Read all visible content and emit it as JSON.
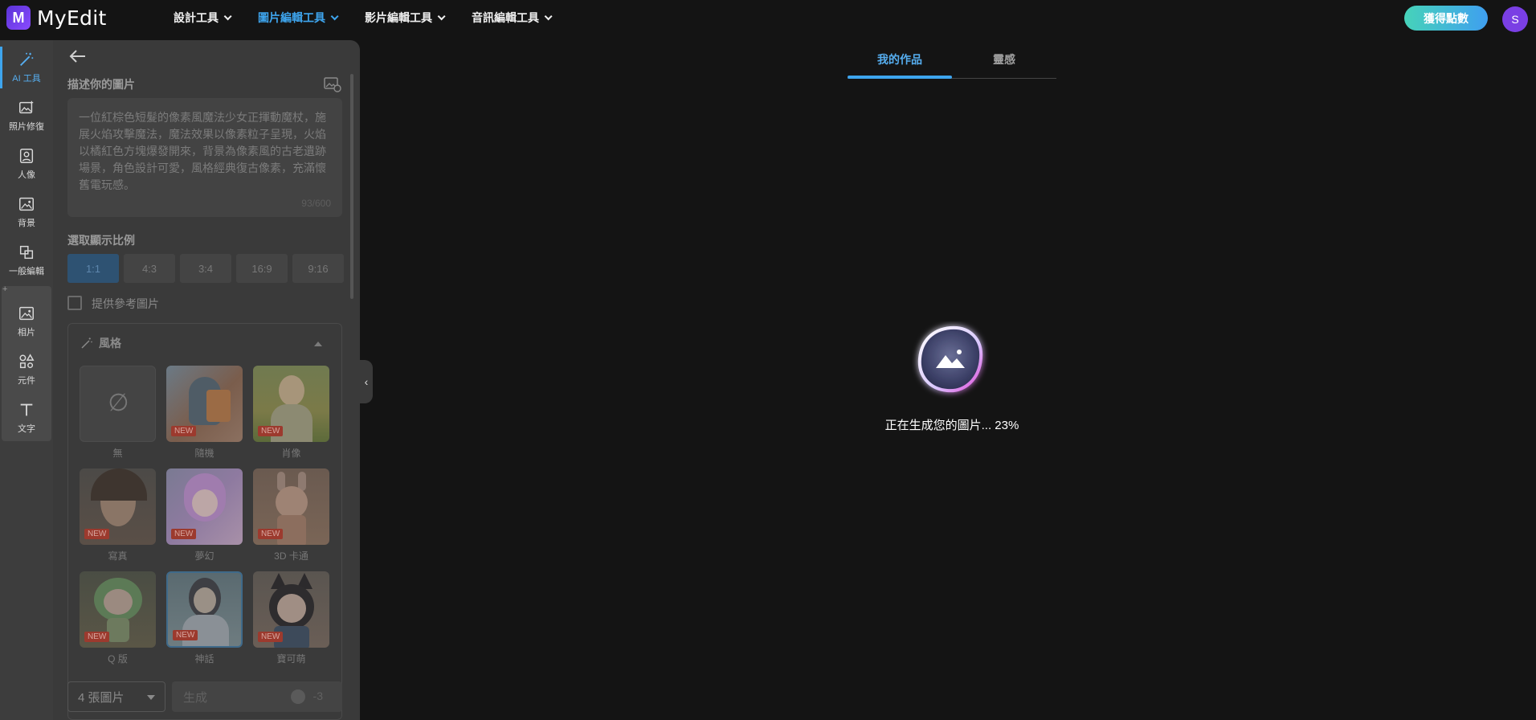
{
  "app": {
    "name": "MyEdit",
    "logo_letter": "M"
  },
  "nav": {
    "items": [
      {
        "label": "設計工具",
        "active": false
      },
      {
        "label": "圖片編輯工具",
        "active": true
      },
      {
        "label": "影片編輯工具",
        "active": false
      },
      {
        "label": "音訊編輯工具",
        "active": false
      }
    ]
  },
  "header": {
    "points_button": "獲得點數",
    "avatar_initial": "S"
  },
  "rail": {
    "items": [
      {
        "label": "AI 工具",
        "icon": "magic-wand-icon",
        "active": true
      },
      {
        "label": "照片修復",
        "icon": "photo-restore-icon",
        "active": false
      },
      {
        "label": "人像",
        "icon": "portrait-icon",
        "active": false
      },
      {
        "label": "背景",
        "icon": "background-icon",
        "active": false
      },
      {
        "label": "一般編輯",
        "icon": "crop-icon",
        "active": false
      },
      {
        "label": "相片",
        "icon": "image-icon",
        "active": false
      },
      {
        "label": "元件",
        "icon": "shapes-icon",
        "active": false
      },
      {
        "label": "文字",
        "icon": "text-icon",
        "active": false
      }
    ]
  },
  "panel": {
    "describe_label": "描述你的圖片",
    "prompt_text": "一位紅棕色短髮的像素風魔法少女正揮動魔杖，施展火焰攻擊魔法，魔法效果以像素粒子呈現，火焰以橘紅色方塊爆發開來，背景為像素風的古老遺跡場景，角色設計可愛，風格經典復古像素，充滿懷舊電玩感。",
    "prompt_counter": "93/600",
    "ratio_label": "選取顯示比例",
    "ratios": [
      {
        "label": "1:1",
        "active": true
      },
      {
        "label": "4:3",
        "active": false
      },
      {
        "label": "3:4",
        "active": false
      },
      {
        "label": "16:9",
        "active": false
      },
      {
        "label": "9:16",
        "active": false
      }
    ],
    "reference_label": "提供參考圖片",
    "style_label": "風格",
    "new_badge": "NEW",
    "styles": [
      {
        "label": "無"
      },
      {
        "label": "隨機"
      },
      {
        "label": "肖像"
      },
      {
        "label": "寫真"
      },
      {
        "label": "夢幻"
      },
      {
        "label": "3D 卡通"
      },
      {
        "label": "Q 版"
      },
      {
        "label": "神話"
      },
      {
        "label": "寶可萌"
      }
    ],
    "image_count": "4 張圖片",
    "generate_label": "生成",
    "generate_cost": "-3"
  },
  "main": {
    "tabs": [
      {
        "label": "我的作品",
        "active": true
      },
      {
        "label": "靈感",
        "active": false
      }
    ],
    "status_text": "正在生成您的圖片... 23%",
    "progress_percent": 23
  },
  "colors": {
    "accent": "#3ea5ee",
    "points_gradient_start": "#46d3b9",
    "points_gradient_end": "#3f9ff0",
    "avatar": "#7a3fe4"
  }
}
